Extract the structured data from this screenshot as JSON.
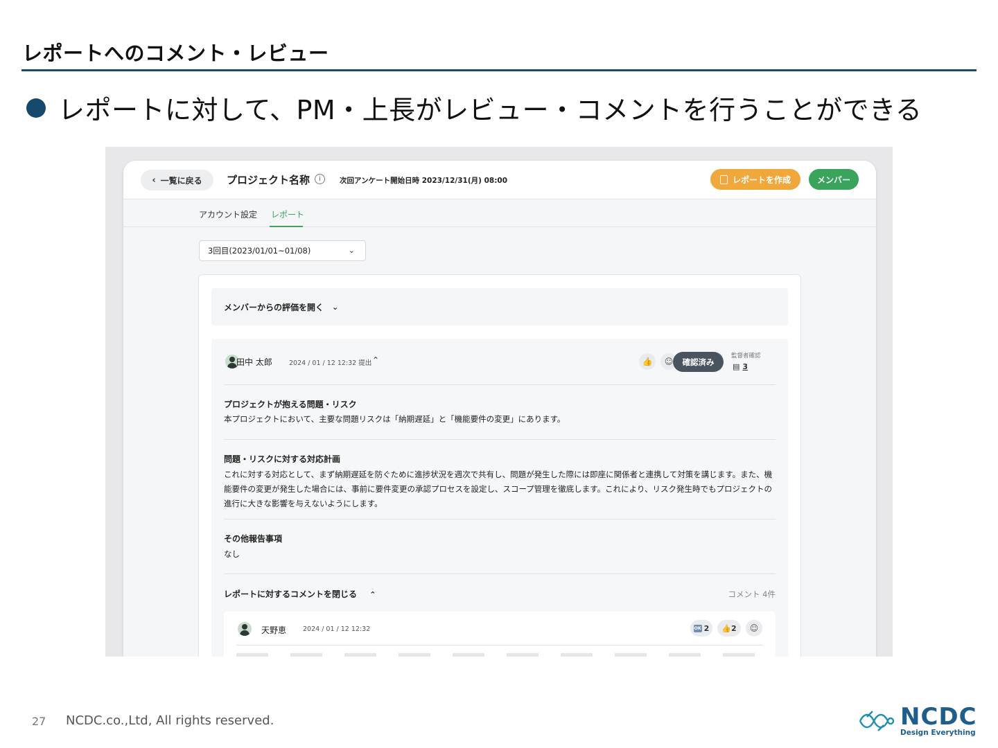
{
  "slide": {
    "title": "レポートへのコメント・レビュー",
    "bullet": "レポートに対して、PM・上長がレビュー・コメントを行うことができる"
  },
  "header": {
    "back_label": "一覧に戻る",
    "project_name": "プロジェクト名称",
    "next_survey": "次回アンケート開始日時 2023/12/31(月) 08:00",
    "create_report_label": "レポートを作成",
    "member_label": "メンバー"
  },
  "tabs": [
    {
      "label": "アカウント設定"
    },
    {
      "label": "レポート"
    }
  ],
  "round_select": {
    "value": "3回目(2023/01/01~01/08)"
  },
  "eval_toggle": {
    "label": "メンバーからの評価を開く"
  },
  "report": {
    "author": "田中 太郎",
    "submitted": "2024 / 01 / 12 12:32 提出",
    "confirmed_label": "確認済み",
    "auditor_label": "監督者確認",
    "auditor_count": "3",
    "sections": [
      {
        "heading": "プロジェクトが抱える問題・リスク",
        "body": "本プロジェクトにおいて、主要な問題リスクは「納期遅延」と「機能要件の変更」にあります。"
      },
      {
        "heading": "問題・リスクに対する対応計画",
        "body": "これに対する対応として、まず納期遅延を防ぐために進捗状況を週次で共有し、問題が発生した際には即座に関係者と連携して対策を講じます。また、機能要件の変更が発生した場合には、事前に要件変更の承認プロセスを設定し、スコープ管理を徹底します。これにより、リスク発生時でもプロジェクトの進行に大きな影響を与えないようにします。"
      },
      {
        "heading": "その他報告事項",
        "body": "なし"
      }
    ],
    "comments_toggle": "レポートに対するコメントを閉じる",
    "comment_count": "コメント 4件"
  },
  "comment": {
    "author": "天野恵",
    "time": "2024 / 01 / 12 12:32",
    "ok_badge": "OK",
    "ok_count": "2",
    "like_count": "2"
  },
  "footer": {
    "page": "27",
    "copyright": "NCDC.co.,Ltd, All rights reserved.",
    "logo_name": "NCDC",
    "logo_tagline": "Design Everything"
  },
  "colors": {
    "accent_green": "#3aa35c",
    "accent_orange": "#f0a73b",
    "title_rule": "#1c4a6c",
    "logo_blue": "#1d5e8c"
  }
}
